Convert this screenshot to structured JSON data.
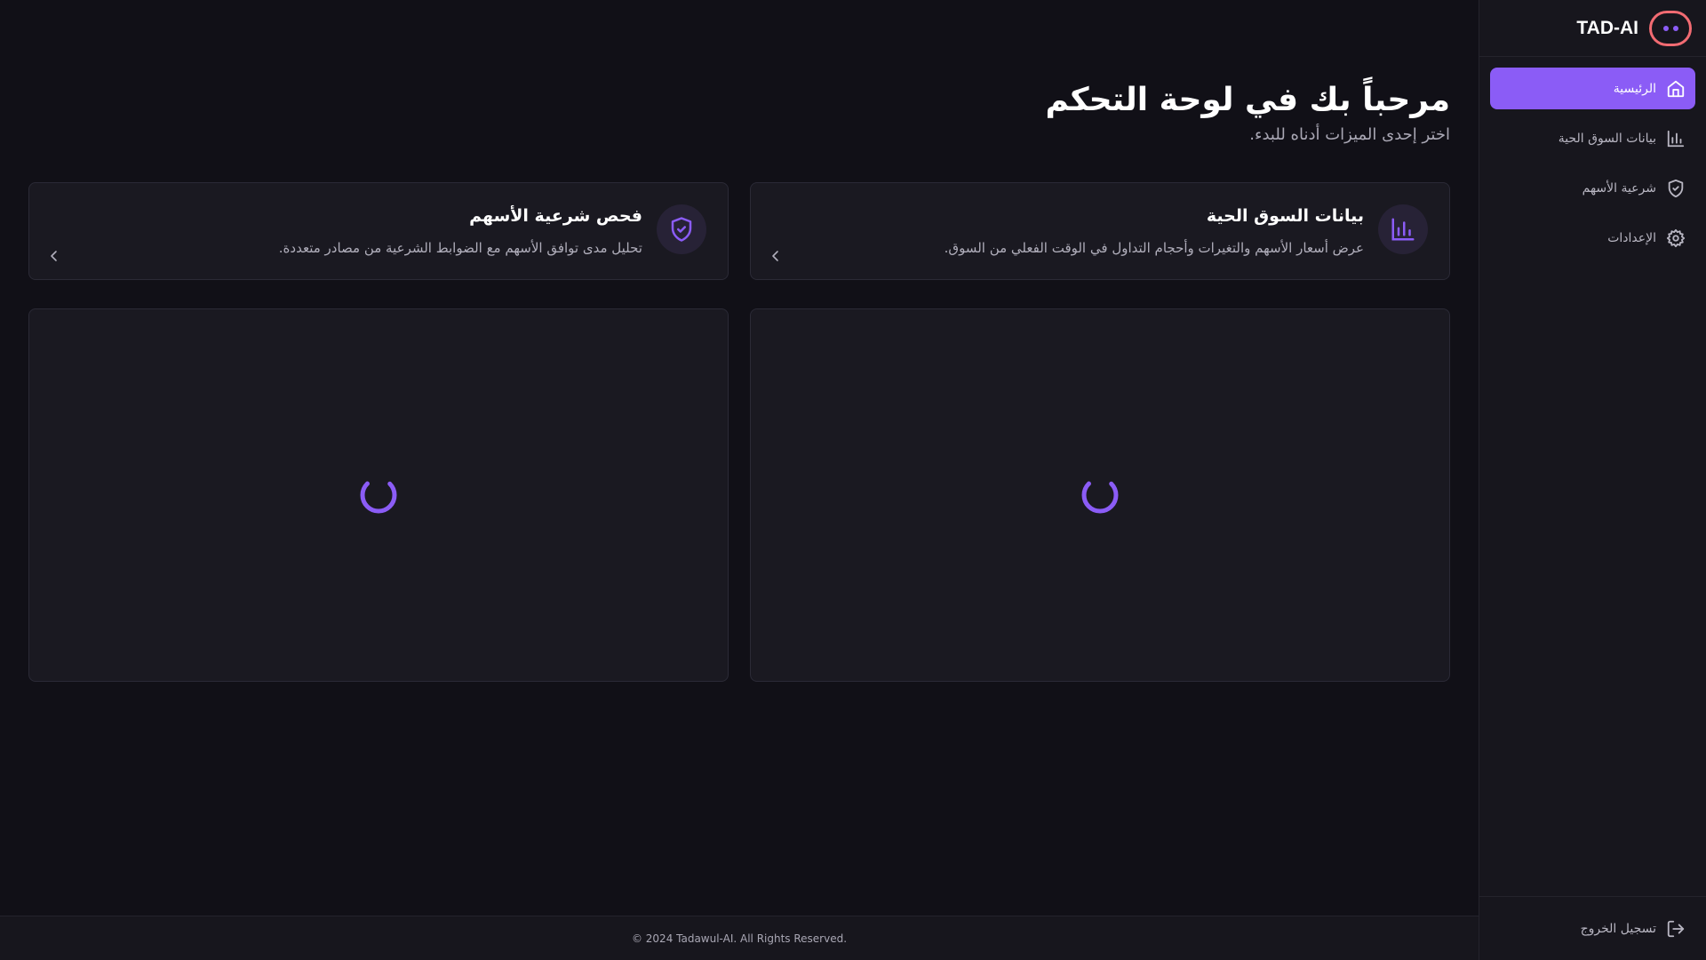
{
  "app": {
    "brand": "TAD-AI"
  },
  "sidebar": {
    "items": [
      {
        "label": "الرئيسية",
        "icon": "home-icon",
        "active": true
      },
      {
        "label": "بيانات السوق الحية",
        "icon": "bar-chart-icon",
        "active": false
      },
      {
        "label": "شرعية الأسهم",
        "icon": "shield-check-icon",
        "active": false
      },
      {
        "label": "الإعدادات",
        "icon": "gear-icon",
        "active": false
      }
    ],
    "logout_label": "تسجيل الخروج"
  },
  "main": {
    "title": "مرحباً بك في لوحة التحكم",
    "subtitle": "اختر إحدى الميزات أدناه للبدء.",
    "cards": [
      {
        "title": "بيانات السوق الحية",
        "description": "عرض أسعار الأسهم والتغيرات وأحجام التداول في الوقت الفعلي من السوق.",
        "icon": "bar-chart-icon"
      },
      {
        "title": "فحص شرعية الأسهم",
        "description": "تحليل مدى توافق الأسهم مع الضوابط الشرعية من مصادر متعددة.",
        "icon": "shield-check-icon"
      }
    ]
  },
  "footer": {
    "copyright": "© 2024 Tadawul-AI. All Rights Reserved."
  },
  "colors": {
    "accent": "#8b5cf6",
    "background": "#111017",
    "panel": "#1a1921",
    "logo_ring": "#f26b72"
  }
}
